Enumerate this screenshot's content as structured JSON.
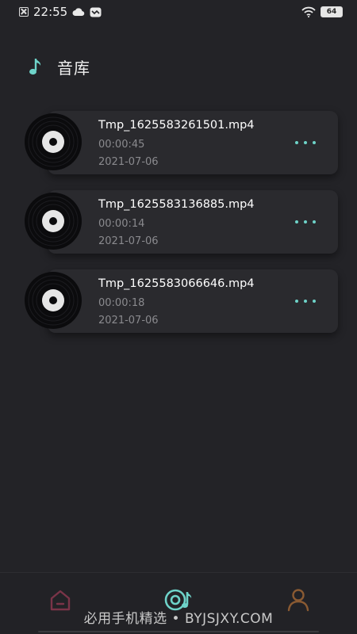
{
  "status_bar": {
    "time": "22:55",
    "battery": "64"
  },
  "header": {
    "title": "音库"
  },
  "tracks": [
    {
      "name": "Tmp_1625583261501.mp4",
      "duration": "00:00:45",
      "date": "2021-07-06"
    },
    {
      "name": "Tmp_1625583136885.mp4",
      "duration": "00:00:14",
      "date": "2021-07-06"
    },
    {
      "name": "Tmp_1625583066646.mp4",
      "duration": "00:00:18",
      "date": "2021-07-06"
    }
  ],
  "nav": {
    "items": [
      {
        "icon": "home-icon",
        "active": false,
        "color": "#7a3448"
      },
      {
        "icon": "music-library-icon",
        "active": true,
        "color": "#6ed3c9"
      },
      {
        "icon": "user-icon",
        "active": false,
        "color": "#8a5a32"
      }
    ]
  },
  "watermark": "必用手机精选 • BYJSJXY.COM",
  "colors": {
    "accent": "#6ed3c9",
    "background": "#232327",
    "card": "#2a2a2e"
  }
}
